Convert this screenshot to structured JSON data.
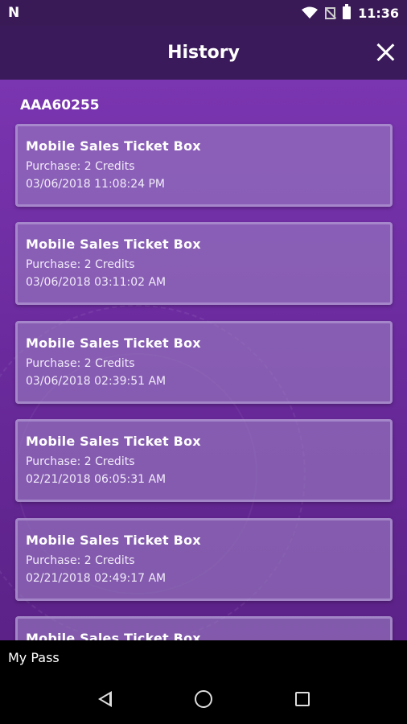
{
  "status_bar": {
    "logo": "N",
    "time": "11:36"
  },
  "app_bar": {
    "title": "History"
  },
  "account_id": "AAA60255",
  "history": [
    {
      "title": "Mobile Sales Ticket Box",
      "purchase": "Purchase: 2 Credits",
      "timestamp": "03/06/2018 11:08:24 PM"
    },
    {
      "title": "Mobile Sales Ticket Box",
      "purchase": "Purchase: 2 Credits",
      "timestamp": "03/06/2018 03:11:02 AM"
    },
    {
      "title": "Mobile Sales Ticket Box",
      "purchase": "Purchase: 2 Credits",
      "timestamp": "03/06/2018 02:39:51 AM"
    },
    {
      "title": "Mobile Sales Ticket Box",
      "purchase": "Purchase: 2 Credits",
      "timestamp": "02/21/2018 06:05:31 AM"
    },
    {
      "title": "Mobile Sales Ticket Box",
      "purchase": "Purchase: 2 Credits",
      "timestamp": "02/21/2018 02:49:17 AM"
    },
    {
      "title": "Mobile Sales Ticket Box",
      "purchase": "",
      "timestamp": ""
    }
  ],
  "bottom_label": "My Pass",
  "icons": {
    "close": "close-icon",
    "wifi": "wifi-icon",
    "no_sim": "no-sim-icon",
    "battery": "battery-icon",
    "back": "back-icon",
    "home": "home-icon",
    "recents": "recents-icon"
  },
  "colors": {
    "app_bar": "#3a1a5a",
    "background": "#6a2a9a",
    "card": "#9678be"
  }
}
